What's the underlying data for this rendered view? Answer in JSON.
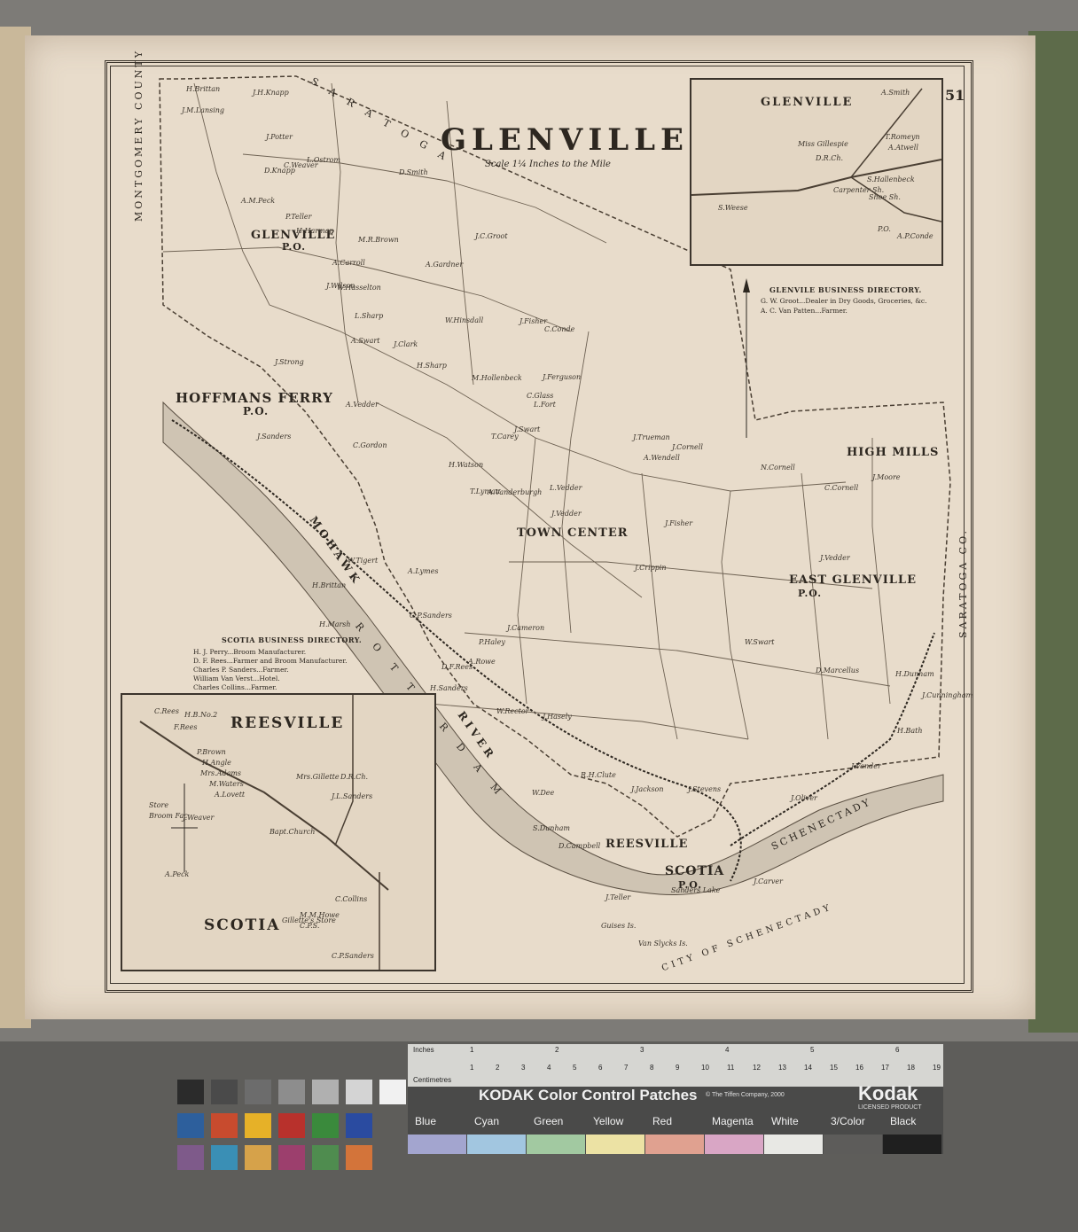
{
  "map": {
    "title": "GLENVILLE",
    "scale": "Scale 1¼ Inches to the Mile",
    "page_number": "51",
    "towns": {
      "glenville_po": "GLENVILLE",
      "glenville_po_sub": "P.O.",
      "hoffmans_ferry": "HOFFMANS FERRY",
      "hoffmans_ferry_sub": "P.O.",
      "town_center": "TOWN CENTER",
      "high_mills": "HIGH MILLS",
      "east_glenville": "EAST GLENVILLE",
      "east_glenville_sub": "P.O.",
      "reesville": "REESVILLE",
      "scotia": "SCOTIA",
      "scotia_sub": "P.O."
    },
    "borders": {
      "montgomery": "MONTGOMERY COUNTY",
      "saratoga_top": "S A R A T O G A",
      "saratoga_right": "SARATOGA CO.",
      "schenectady": "SCHENECTADY",
      "city_of_schenectady": "CITY OF SCHENECTADY",
      "mohawk": "MOHAWK",
      "river": "RIVER",
      "rotterdam": "R O T T E R D A M"
    },
    "features": {
      "sanders_lake": "Sanders Lake",
      "van_slycks": "Van Slycks Is.",
      "guises": "Guises Is."
    },
    "owners": [
      "H.Brittan",
      "J.H.Knapp",
      "J.M.Lansing",
      "J.Potter",
      "L.Ostrom",
      "D.Knapp",
      "C.Weaver",
      "D.Smith",
      "A.M.Peck",
      "P.Teller",
      "H.Harman",
      "M.R.Brown",
      "A.Gardner",
      "J.C.Groot",
      "A.Carroll",
      "J.Wilson",
      "L.Sharp",
      "W.Hinsdall",
      "J.Fisher",
      "C.Conde",
      "J.Clark",
      "H.Sharp",
      "M.Hollenbeck",
      "J.Ferguson",
      "C.Glass",
      "L.Fort",
      "T.Carey",
      "J.Swart",
      "H.Watson",
      "A.Vanderburgh",
      "L.Vedder",
      "J.Vedder",
      "A.Wendell",
      "J.Trueman",
      "J.Cornell",
      "J.Fisher",
      "J.Crippin",
      "N.Cornell",
      "C.Cornell",
      "J.Moore",
      "J.Vedder",
      "W.Swart",
      "D.Marcellus",
      "H.Dunham",
      "J.Cunningham",
      "H.Bath",
      "J.Vander",
      "J.Oliver",
      "W.Dee",
      "S.Dunham",
      "J.Stevens",
      "J.Jackson",
      "J.Carver",
      "T.Lyman",
      "C.Gordon",
      "A.Swart",
      "W.Hasselton",
      "J.Strong",
      "A.Vedder",
      "J.Sanders",
      "C.P.Sanders",
      "D.F.Rees",
      "H.Sanders",
      "A.Rowe",
      "J.Cameron",
      "W.Rector",
      "J.Hasely",
      "R.H.Clute",
      "D.Campbell",
      "J.Teller",
      "P.Haley",
      "A.Lymes",
      "H.Marsh",
      "H.Brittan",
      "W.Tigert"
    ],
    "inset_glenville": {
      "title": "GLENVILLE",
      "labels": [
        "A.Smith",
        "T.Romeyn",
        "A.Atwell",
        "Miss Gillespie",
        "D.R.Ch.",
        "Carpenter Sh.",
        "S.Hallenbeck",
        "S.Weese",
        "Shoe Sh.",
        "P.O.",
        "A.P.Conde"
      ]
    },
    "business_glenville": {
      "title": "GLENVILE BUSINESS DIRECTORY.",
      "lines": [
        "G. W. Groot...Dealer in Dry Goods, Groceries, &c.",
        "A. C. Van Patten...Farmer."
      ]
    },
    "business_scotia": {
      "title": "SCOTIA BUSINESS DIRECTORY.",
      "lines": [
        "H. J. Perry...Broom Manufacturer.",
        "D. F. Rees...Farmer and Broom Manufacturer.",
        "Charles P. Sanders...Farmer.",
        "William Van Verst...Hotel.",
        "Charles Collins...Farmer."
      ]
    },
    "inset_reesville": {
      "title": "REESVILLE",
      "title2": "SCOTIA",
      "labels": [
        "C.Rees",
        "H.B.No.2",
        "F.Rees",
        "P.Brown",
        "H.Angle",
        "Mrs.Adams",
        "M.Waters",
        "A.Lovett",
        "J.Weaver",
        "Mrs.Gillette",
        "D.R.Ch.",
        "J.L.Sanders",
        "Bapt.Church",
        "A.Peck",
        "C.Collins",
        "C.P.S.",
        "M.M.Howe",
        "C.P.Sanders",
        "Store",
        "Broom Fac.",
        "Gillette's Store"
      ]
    }
  },
  "kodak": {
    "inches": "Inches",
    "centimetres": "Centimetres",
    "title": "KODAK Color Control Patches",
    "copyright": "© The Tiffen Company, 2000",
    "brand": "Kodak",
    "licensed": "LICENSED PRODUCT",
    "patches": [
      "Blue",
      "Cyan",
      "Green",
      "Yellow",
      "Red",
      "Magenta",
      "White",
      "3/Color",
      "Black"
    ],
    "patch_colors": [
      "#a3a5cf",
      "#a2c6e0",
      "#a2c9a1",
      "#ece2a4",
      "#e0a190",
      "#d9a6c5",
      "#e8e8e4",
      "#5d5c5a",
      "#1f1f1f"
    ],
    "ruler_numbers": [
      "1",
      "2",
      "3",
      "4",
      "5",
      "6",
      "7",
      "8",
      "9",
      "10",
      "11",
      "12",
      "13",
      "14",
      "15",
      "16",
      "17",
      "18",
      "19"
    ],
    "inch_numbers": [
      "1",
      "2",
      "3",
      "4",
      "5",
      "6"
    ]
  },
  "grey_patches": [
    "#2b2b2b",
    "#4a4a4a",
    "#6c6c6c",
    "#8d8d8d",
    "#b0b0b0",
    "#d4d4d4",
    "#f1f1f1"
  ],
  "color_patches": [
    "#2d5f9c",
    "#c84b2e",
    "#e6b128",
    "#b8312c",
    "#3a8a3c",
    "#2a4ba0",
    "#7e5a8a",
    "#3a8fb5",
    "#d6a24a",
    "#9c3f6d",
    "#4f8c4f",
    "#d3743a"
  ]
}
